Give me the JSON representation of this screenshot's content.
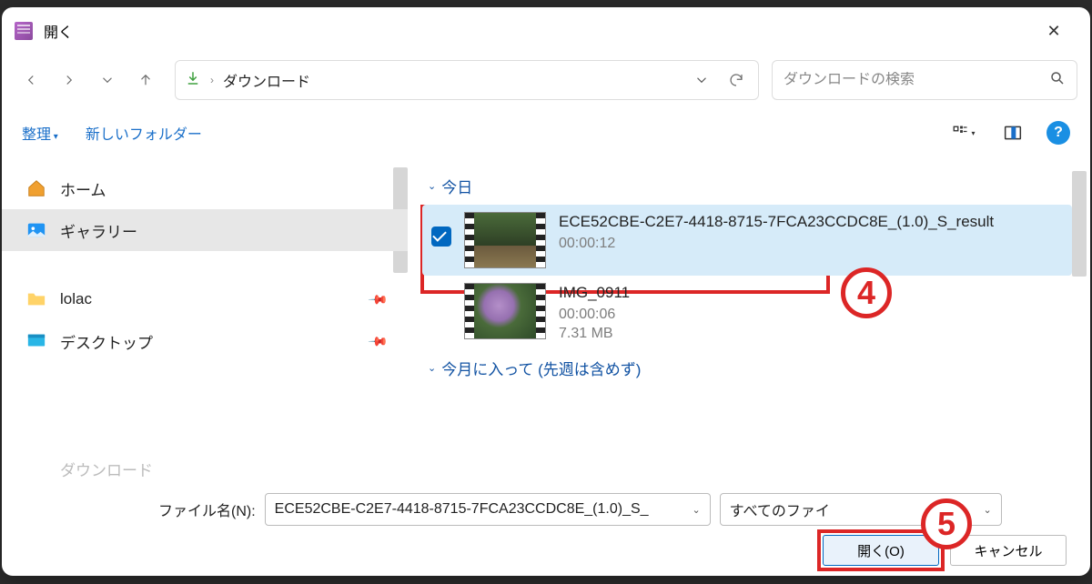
{
  "title": "開く",
  "breadcrumb": "ダウンロード",
  "search_placeholder": "ダウンロードの検索",
  "toolbar": {
    "organize": "整理",
    "newfolder": "新しいフォルダー"
  },
  "sidebar": {
    "home": "ホーム",
    "gallery": "ギャラリー",
    "lolac": "lolac",
    "desktop": "デスクトップ",
    "downloads_cut": "ダウンロード"
  },
  "groups": {
    "today": "今日",
    "month": "今月に入って (先週は含めず)"
  },
  "files": [
    {
      "name": "ECE52CBE-C2E7-4418-8715-7FCA23CCDC8E_(1.0)_S_result",
      "duration": "00:00:12"
    },
    {
      "name": "IMG_0911",
      "duration": "00:00:06",
      "size": "7.31 MB"
    }
  ],
  "footer": {
    "filename_label": "ファイル名(N):",
    "filename_value": "ECE52CBE-C2E7-4418-8715-7FCA23CCDC8E_(1.0)_S_",
    "filetype_value": "すべてのファイ",
    "open": "開く(O)",
    "cancel": "キャンセル"
  },
  "annotations": {
    "four": "4",
    "five": "5"
  }
}
